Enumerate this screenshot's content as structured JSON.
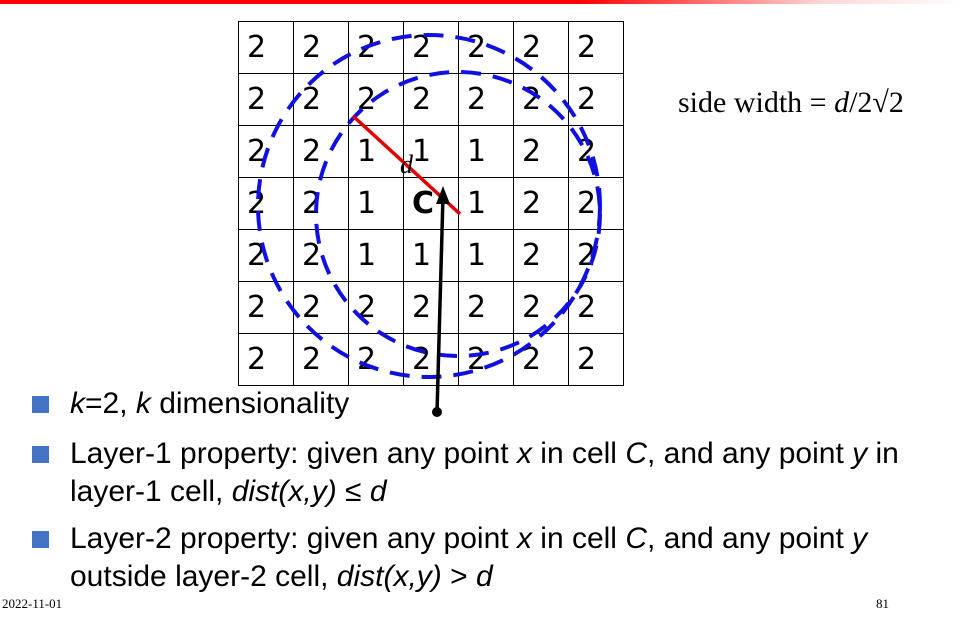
{
  "grid": {
    "rows": [
      [
        "2",
        "2",
        "2",
        "2",
        "2",
        "2",
        "2"
      ],
      [
        "2",
        "2",
        "2",
        "2",
        "2",
        "2",
        "2"
      ],
      [
        "2",
        "2",
        "1",
        "1",
        "1",
        "2",
        "2"
      ],
      [
        "2",
        "2",
        "1",
        "C",
        "1",
        "2",
        "2"
      ],
      [
        "2",
        "2",
        "1",
        "1",
        "1",
        "2",
        "2"
      ],
      [
        "2",
        "2",
        "2",
        "2",
        "2",
        "2",
        "2"
      ],
      [
        "2",
        "2",
        "2",
        "2",
        "2",
        "2",
        "2"
      ]
    ]
  },
  "diagram": {
    "d_label": "d",
    "side_width_text": "side width = ",
    "side_width_d": "d",
    "side_width_rest": "/2√2"
  },
  "bullets": {
    "b1": {
      "k1": "k",
      "t1": "=2, ",
      "k2": "k",
      "t2": " dimensionality"
    },
    "b2": {
      "t1": "Layer-1 property: given any point ",
      "x": "x",
      "t2": " in cell ",
      "c": "C",
      "t3": ", and any point ",
      "y": "y",
      "t4": " in layer-1 cell, ",
      "dist": "dist(x,y)",
      "t5": " ≤ ",
      "d": "d"
    },
    "b3": {
      "t1": "Layer-2 property: given any point ",
      "x": "x",
      "t2": " in cell ",
      "c": "C",
      "t3": ", and any point ",
      "y": "y",
      "t4": " outside layer-2 cell, ",
      "dist": "dist(x,y)",
      "t5": " > ",
      "d": "d"
    }
  },
  "footer": {
    "date": "2022-11-01",
    "page": "81"
  },
  "colors": {
    "accent_bar": "#ff0000",
    "circle": "#1010e0",
    "diameter_line": "#e00000",
    "bullet": "#4472c4"
  }
}
